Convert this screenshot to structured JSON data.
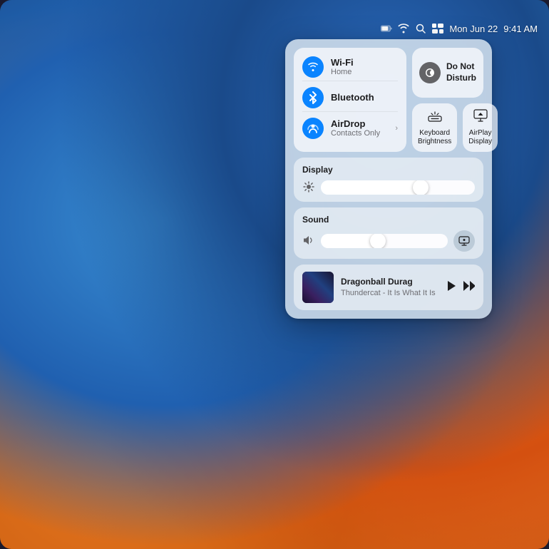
{
  "menubar": {
    "date": "Mon Jun 22",
    "time": "9:41 AM"
  },
  "controlCenter": {
    "wifi": {
      "name": "Wi-Fi",
      "sub": "Home",
      "active": true
    },
    "bluetooth": {
      "name": "Bluetooth",
      "active": true
    },
    "airdrop": {
      "name": "AirDrop",
      "sub": "Contacts Only",
      "active": true
    },
    "doNotDisturb": {
      "name": "Do Not Disturb"
    },
    "keyboardBrightness": {
      "name": "Keyboard Brightness"
    },
    "airplayDisplay": {
      "name": "AirPlay Display"
    },
    "display": {
      "label": "Display",
      "brightness": 65
    },
    "sound": {
      "label": "Sound",
      "volume": 45
    },
    "nowPlaying": {
      "track": "Dragonball Durag",
      "artist": "Thundercat - It Is What It Is"
    }
  }
}
